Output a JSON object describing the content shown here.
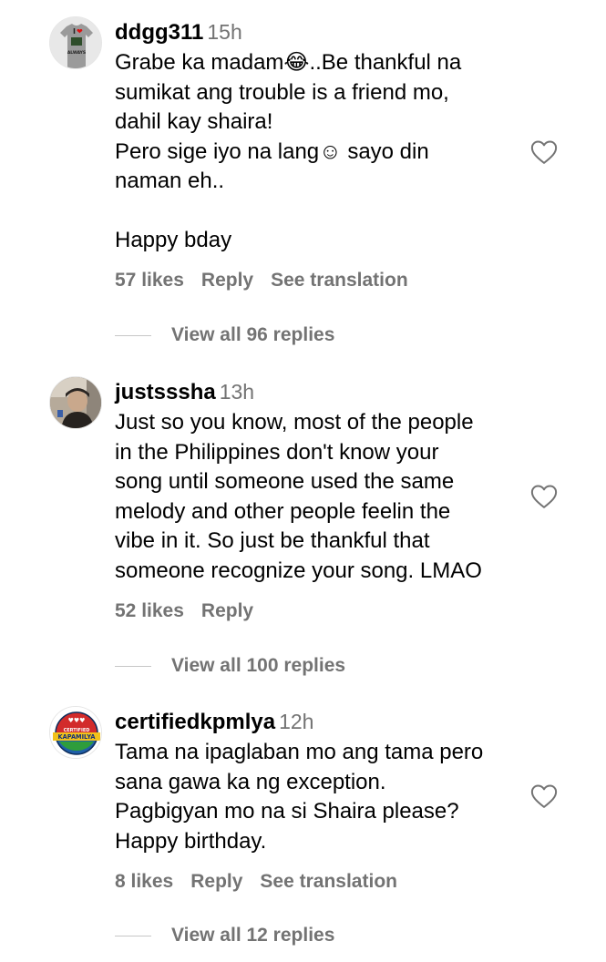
{
  "comments": [
    {
      "username": "ddgg311",
      "time": "15h",
      "lines": [
        "Grabe ka madam😂..Be thankful na",
        "sumikat ang trouble is a friend mo,",
        "dahil kay shaira!",
        "Pero sige iyo na lang☺ sayo din",
        "naman eh..",
        "",
        "Happy bday"
      ],
      "likes": "57 likes",
      "reply": "Reply",
      "translation": "See translation",
      "view_replies": "View all 96 replies",
      "avatar_text": "I ❤ ALWAYS",
      "avatar_icon": "tshirt-avatar"
    },
    {
      "username": "justsssha",
      "time": "13h",
      "lines": [
        "Just so you know, most of the people",
        "in the Philippines don't know your",
        "song until someone used the same",
        "melody and other people feelin the",
        "vibe in it. So just be thankful that",
        "someone recognize your song. LMAO"
      ],
      "likes": "52 likes",
      "reply": "Reply",
      "view_replies": "View all 100 replies",
      "avatar_icon": "photo-avatar"
    },
    {
      "username": "certifiedkpmlya",
      "time": "12h",
      "lines": [
        "Tama na ipaglaban mo ang tama pero",
        "sana gawa ka ng exception.",
        "Pagbigyan mo na si Shaira please?",
        "Happy birthday."
      ],
      "likes": "8 likes",
      "reply": "Reply",
      "translation": "See translation",
      "view_replies": "View all 12 replies",
      "avatar_text_top": "CERTIFIED",
      "avatar_text_bottom": "KAPAMILYA",
      "avatar_icon": "kapamilya-logo-avatar"
    }
  ],
  "icons": {
    "like": "heart-outline-icon"
  },
  "colors": {
    "text": "#000000",
    "secondary": "#737373",
    "divider": "#c7c7c7",
    "background": "#ffffff"
  }
}
